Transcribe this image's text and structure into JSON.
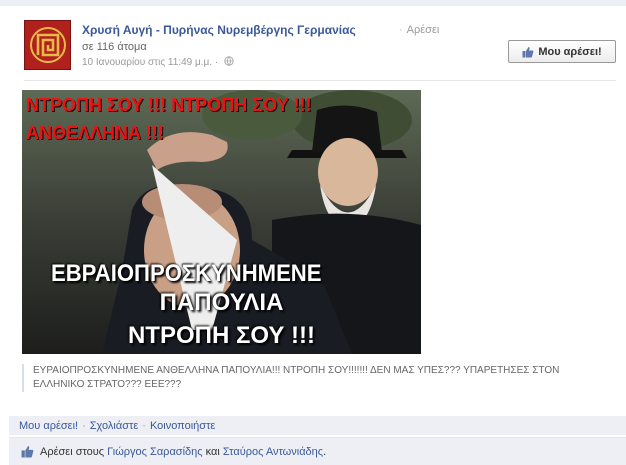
{
  "header": {
    "page_name": "Χρυσή Αυγή - Πυρήνας Νυρεμβέργης Γερμανίας",
    "like_link": "Αρέσει",
    "count": "σε 116 άτομα",
    "timestamp": "10 Ιανουαρίου στις 11:49 μ.μ.",
    "timestamp_sep": "·",
    "like_page_button": "Μου αρέσει!"
  },
  "image": {
    "red_line1": "ΝΤΡΟΠΗ ΣΟΥ !!! ΝΤΡΟΠΗ ΣΟΥ !!!",
    "red_line2": "ΑΝΘΕΛΛΗΝΑ !!!",
    "white_line1": "ΕΒΡΑΙΟΠΡΟΣΚΥΝΗΜΕΝΕ",
    "white_line2": "ΠΑΠΟΥΛΙΑ",
    "white_line3": "ΝΤΡΟΠΗ ΣΟΥ !!!"
  },
  "caption": "ΕΥΡΑΙΟΠΡΟΣΚΥΝΗΜΕΝΕ ΑΝΘΕΛΛΗΝΑ ΠΑΠΟΥΛΙΑ!!! ΝΤΡΟΠΗ ΣΟΥ!!!!!!! ΔΕΝ ΜΑΣ ΥΠΕΣ??? ΥΠΑΡΕΤΗΣΕΣ ΣΤΟΝ ΕΛΛΗΝΙΚΟ ΣΤΡΑΤΟ??? ΕΕΕ???",
  "actions": {
    "like": "Μου αρέσει!",
    "comment": "Σχολιάστε",
    "share": "Κοινοποιήστε",
    "sep": "·"
  },
  "likes": {
    "prefix": "Αρέσει στους",
    "user1": "Γιώργος Σαρασίδης",
    "conj": "και",
    "user2": "Σταύρος Αντωνιάδης",
    "suffix": "."
  },
  "colors": {
    "link": "#3b5998",
    "bar_bg": "#edeff4",
    "avatar_red": "#b0201d",
    "image_red_text": "#ee1111"
  },
  "icons": [
    "meander-logo-icon",
    "globe-icon",
    "thumbs-up-icon"
  ]
}
